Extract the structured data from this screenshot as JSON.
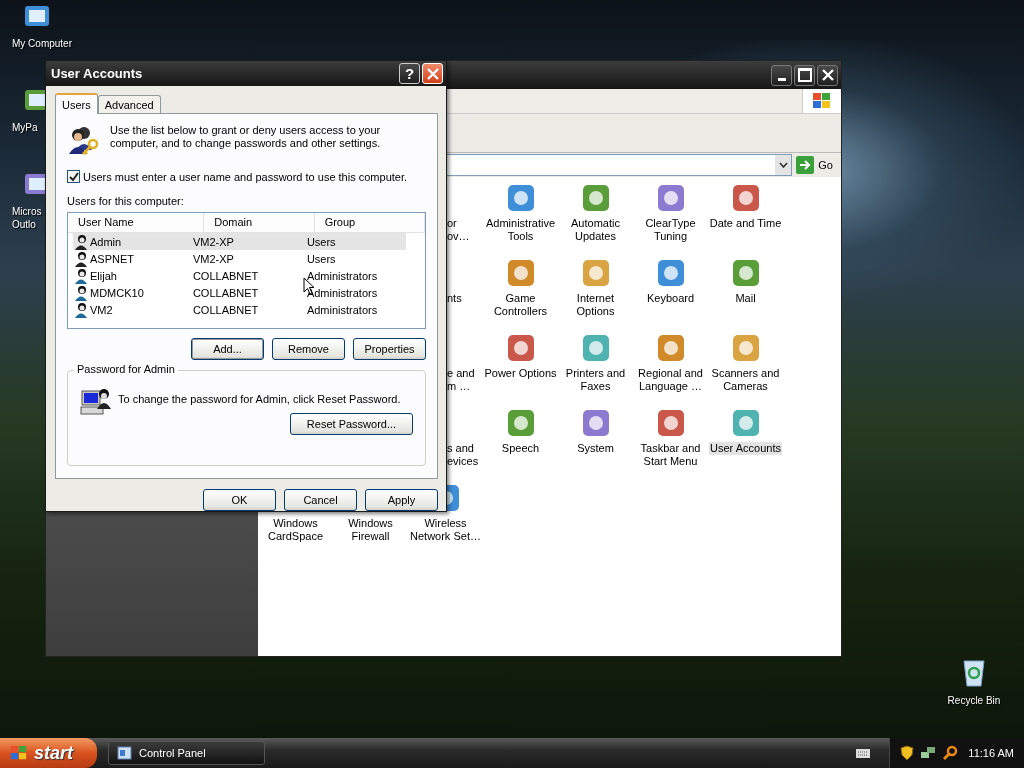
{
  "desktop_icons": [
    {
      "lines": [
        "My Computer"
      ]
    },
    {
      "lines": [
        "MyPa"
      ]
    },
    {
      "lines": [
        "Micros",
        "Outlo"
      ]
    }
  ],
  "recycle_bin": {
    "label": "Recycle Bin"
  },
  "control_panel": {
    "go_button": "Go",
    "items": [
      {
        "kind": "partial",
        "lines": [
          "or",
          "ov…"
        ],
        "selected": false
      },
      {
        "kind": "full",
        "lines": [
          "Administrative",
          "Tools"
        ],
        "selected": false
      },
      {
        "kind": "full",
        "lines": [
          "Automatic",
          "Updates"
        ],
        "selected": false
      },
      {
        "kind": "full",
        "lines": [
          "ClearType",
          "Tuning"
        ],
        "selected": false
      },
      {
        "kind": "full",
        "lines": [
          "Date and Time"
        ],
        "selected": false
      },
      {
        "kind": "partial",
        "lines": [
          "nts"
        ],
        "selected": false
      },
      {
        "kind": "full",
        "lines": [
          "Game",
          "Controllers"
        ],
        "selected": false
      },
      {
        "kind": "full",
        "lines": [
          "Internet",
          "Options"
        ],
        "selected": false
      },
      {
        "kind": "full",
        "lines": [
          "Keyboard"
        ],
        "selected": false
      },
      {
        "kind": "full",
        "lines": [
          "Mail"
        ],
        "selected": false
      },
      {
        "kind": "partial",
        "lines": [
          "e and",
          "m …"
        ],
        "selected": false
      },
      {
        "kind": "full",
        "lines": [
          "Power Options"
        ],
        "selected": false
      },
      {
        "kind": "full",
        "lines": [
          "Printers and",
          "Faxes"
        ],
        "selected": false
      },
      {
        "kind": "full",
        "lines": [
          "Regional and",
          "Language …"
        ],
        "selected": false
      },
      {
        "kind": "full",
        "lines": [
          "Scanners and",
          "Cameras"
        ],
        "selected": false
      },
      {
        "kind": "partial",
        "lines": [
          "s and",
          "evices"
        ],
        "selected": false
      },
      {
        "kind": "full",
        "lines": [
          "Speech"
        ],
        "selected": false
      },
      {
        "kind": "full",
        "lines": [
          "System"
        ],
        "selected": false
      },
      {
        "kind": "full",
        "lines": [
          "Taskbar and",
          "Start Menu"
        ],
        "selected": false
      },
      {
        "kind": "full",
        "lines": [
          "User Accounts"
        ],
        "selected": true
      },
      {
        "kind": "full",
        "lines": [
          "Windows",
          "CardSpace"
        ],
        "selected": false
      },
      {
        "kind": "full",
        "lines": [
          "Windows",
          "Firewall"
        ],
        "selected": false
      },
      {
        "kind": "full",
        "lines": [
          "Wireless",
          "Network Set…"
        ],
        "selected": false
      }
    ]
  },
  "dialog": {
    "title": "User Accounts",
    "help_button": "?",
    "tabs": [
      {
        "label": "Users",
        "selected": true
      },
      {
        "label": "Advanced",
        "selected": false
      }
    ],
    "description": "Use the list below to grant or deny users access to your computer, and to change passwords and other settings.",
    "require_password": {
      "label": "Users must enter a user name and password to use this computer.",
      "checked": true
    },
    "list_label": "Users for this computer:",
    "columns": [
      "User Name",
      "Domain",
      "Group"
    ],
    "rows": [
      {
        "cells": [
          "Admin",
          "VM2-XP",
          "Users"
        ],
        "selected": true
      },
      {
        "cells": [
          "ASPNET",
          "VM2-XP",
          "Users"
        ],
        "selected": false
      },
      {
        "cells": [
          "Elijah",
          "COLLABNET",
          "Administrators"
        ],
        "selected": false
      },
      {
        "cells": [
          "MDMCK10",
          "COLLABNET",
          "Administrators"
        ],
        "selected": false
      },
      {
        "cells": [
          "VM2",
          "COLLABNET",
          "Administrators"
        ],
        "selected": false
      }
    ],
    "list_buttons": [
      "Add...",
      "Remove",
      "Properties"
    ],
    "password_group": {
      "title": "Password for Admin",
      "text": "To change the password for Admin, click Reset Password.",
      "button": "Reset Password..."
    },
    "buttons": [
      "OK",
      "Cancel",
      "Apply"
    ]
  },
  "taskbar": {
    "start": "start",
    "tasks": [
      {
        "label": "Control Panel",
        "selected": false
      }
    ],
    "clock": "11:16 AM"
  }
}
